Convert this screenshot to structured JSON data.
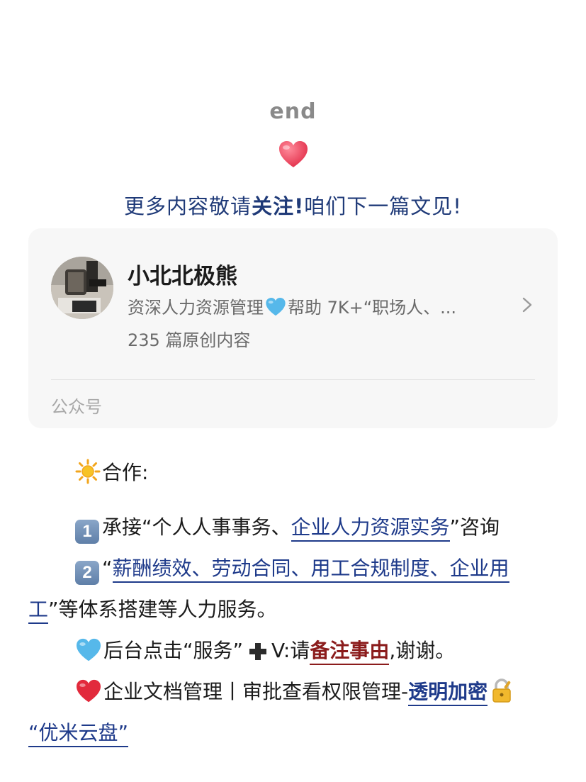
{
  "end_label": "end",
  "follow": {
    "prefix": "更多内容敬请",
    "bold": "关注!",
    "suffix": "咱们下一篇文见!"
  },
  "account_card": {
    "name": "小北北极熊",
    "description_pre": "资深人力资源管理",
    "description_post": "帮助 7K+“职场人、...",
    "count": "235 篇原创内容",
    "type": "公众号",
    "heart_color": "#56b8ea"
  },
  "cooperation": {
    "title": "合作:",
    "item1_key": "1",
    "item1_pre": "承接“个人人事事务、",
    "item1_link": "企业人力资源实务",
    "item1_post": "”咨询",
    "item2_key": "2",
    "item2_open_quote": "“",
    "item2_link_line1": "薪酬绩效、劳动合同、用工合规制度、企业用",
    "item2_link_line2": "工",
    "item2_post": "”等体系搭建等人力服务。",
    "service_pre": "后台点击“服务”",
    "service_mid": "V:请",
    "service_note": "备注事由",
    "service_post": ",谢谢。",
    "doc_pre": "企业文档管理丨审批查看权限管理-",
    "doc_link": "透明加密",
    "product_link": "“优米云盘”"
  },
  "colors": {
    "accent_blue": "#1e3a8a",
    "note_red": "#8b1c1c",
    "heart_red": "#e8344e"
  }
}
